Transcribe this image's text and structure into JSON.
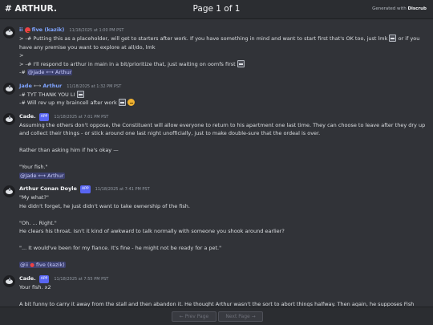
{
  "header": {
    "channel": "# ARTHUR.",
    "page_info": "Page 1 of 1",
    "generated_prefix": "Generated with",
    "generated_brand": "Discrub"
  },
  "colors": {
    "background": "#313338",
    "bar": "#2b2d31",
    "mention": "#c9cdfb",
    "app_badge": "#5865f2",
    "author_five": "#7fa4ff",
    "author_jade": "#7fa4ff",
    "author_default": "#f2f3f5"
  },
  "messages": [
    {
      "author_prefix": "ii",
      "author": "five (kazik)",
      "timestamp": "11/18/2025 at 1:00 PM PST",
      "lines": [
        "> -# Putting this as a placeholder, will get to starters after work. If you have something in mind and want to start first that's OK too, just lmk",
        "or if you have any premise you want to explore at all/do, lmk",
        ">",
        "> -# I'll respond to arthur in main in a bit/prioritize that, just waiting on oomfs first",
        "-#",
        "@Jade",
        "Arthur"
      ]
    },
    {
      "author": "Jade",
      "author_suffix": "Arthur",
      "timestamp": "11/18/2025 at 1:32 PM PST",
      "lines": [
        "-# TYT THANK YOU LI",
        "-# Will rev up my braincell after work"
      ]
    },
    {
      "author": "Cade.",
      "badge": "APP",
      "timestamp": "11/18/2025 at 7:01 PM PST",
      "lines": [
        "Assuming the others don't oppose, the Constituent will allow everyone to return to his apartment one last time. They can choose to leave after they dry up and collect their things - or stick around one last night unofficially, just to make double-sure that the ordeal is over.",
        "Rather than asking him if he's okay —",
        "\"Your fish.\"",
        "@Jade",
        "Arthur"
      ]
    },
    {
      "author": "Arthur Conan Doyle",
      "badge": "APP",
      "timestamp": "11/18/2025 at 7:41 PM PST",
      "lines": [
        "\"My what?\"",
        "He didn't forget, he just didn't want to take ownership of the fish.",
        "\"Oh. ... Right.\"",
        "He clears his throat. Isn't it kind of awkward to talk normally with someone you shook around earlier?",
        "\"... It would've been for my fiance. It's fine - he might not be ready for a pet.\"",
        "@ii",
        "five (kazik)"
      ]
    },
    {
      "author": "Cade.",
      "badge": "APP",
      "timestamp": "11/18/2025 at 7:55 PM PST",
      "lines": [
        "Your fish. x2",
        "A bit funny to carry it away from the stall and then abandon it. He thought Arthur wasn't the sort to abort things halfway. Then again, he supposes Fish wasn't a job."
      ]
    }
  ],
  "footer": {
    "prev_label": "← Prev Page",
    "next_label": "Next Page →"
  }
}
